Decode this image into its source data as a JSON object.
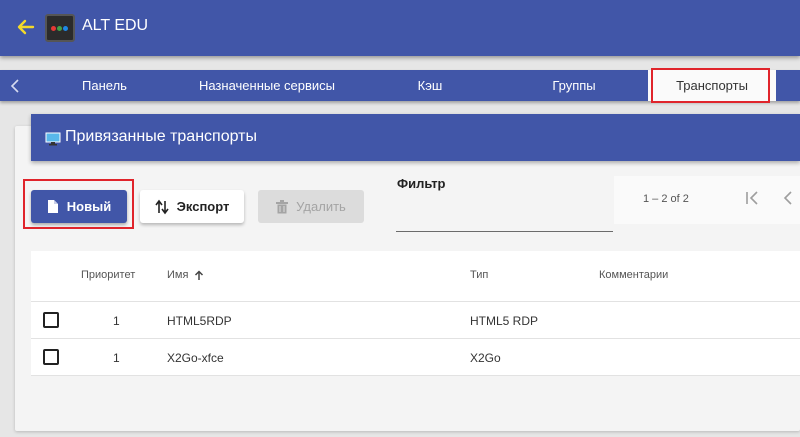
{
  "app": {
    "title": "ALT EDU",
    "accent": "#4156a8",
    "highlight": "#e0242b"
  },
  "tabs": [
    {
      "label": "Панель",
      "active": false
    },
    {
      "label": "Назначенные сервисы",
      "active": false
    },
    {
      "label": "Кэш",
      "active": false
    },
    {
      "label": "Группы",
      "active": false
    },
    {
      "label": "Транспорты",
      "active": true
    }
  ],
  "panel": {
    "title": "Привязанные транспорты",
    "icon": "monitor-icon"
  },
  "toolbar": {
    "new_label": "Новый",
    "export_label": "Экспорт",
    "delete_label": "Удалить"
  },
  "filter": {
    "label": "Фильтр",
    "value": ""
  },
  "paginator": {
    "range": "1 – 2 of 2"
  },
  "table": {
    "headers": {
      "priority": "Приоритет",
      "name": "Имя",
      "type": "Тип",
      "comments": "Комментарии"
    },
    "sort": {
      "column": "name",
      "direction": "ascending"
    },
    "rows": [
      {
        "priority": "1",
        "name": "HTML5RDP",
        "type": "HTML5 RDP",
        "comments": "",
        "checked": false
      },
      {
        "priority": "1",
        "name": "X2Go-xfce",
        "type": "X2Go",
        "comments": "",
        "checked": false
      }
    ]
  }
}
